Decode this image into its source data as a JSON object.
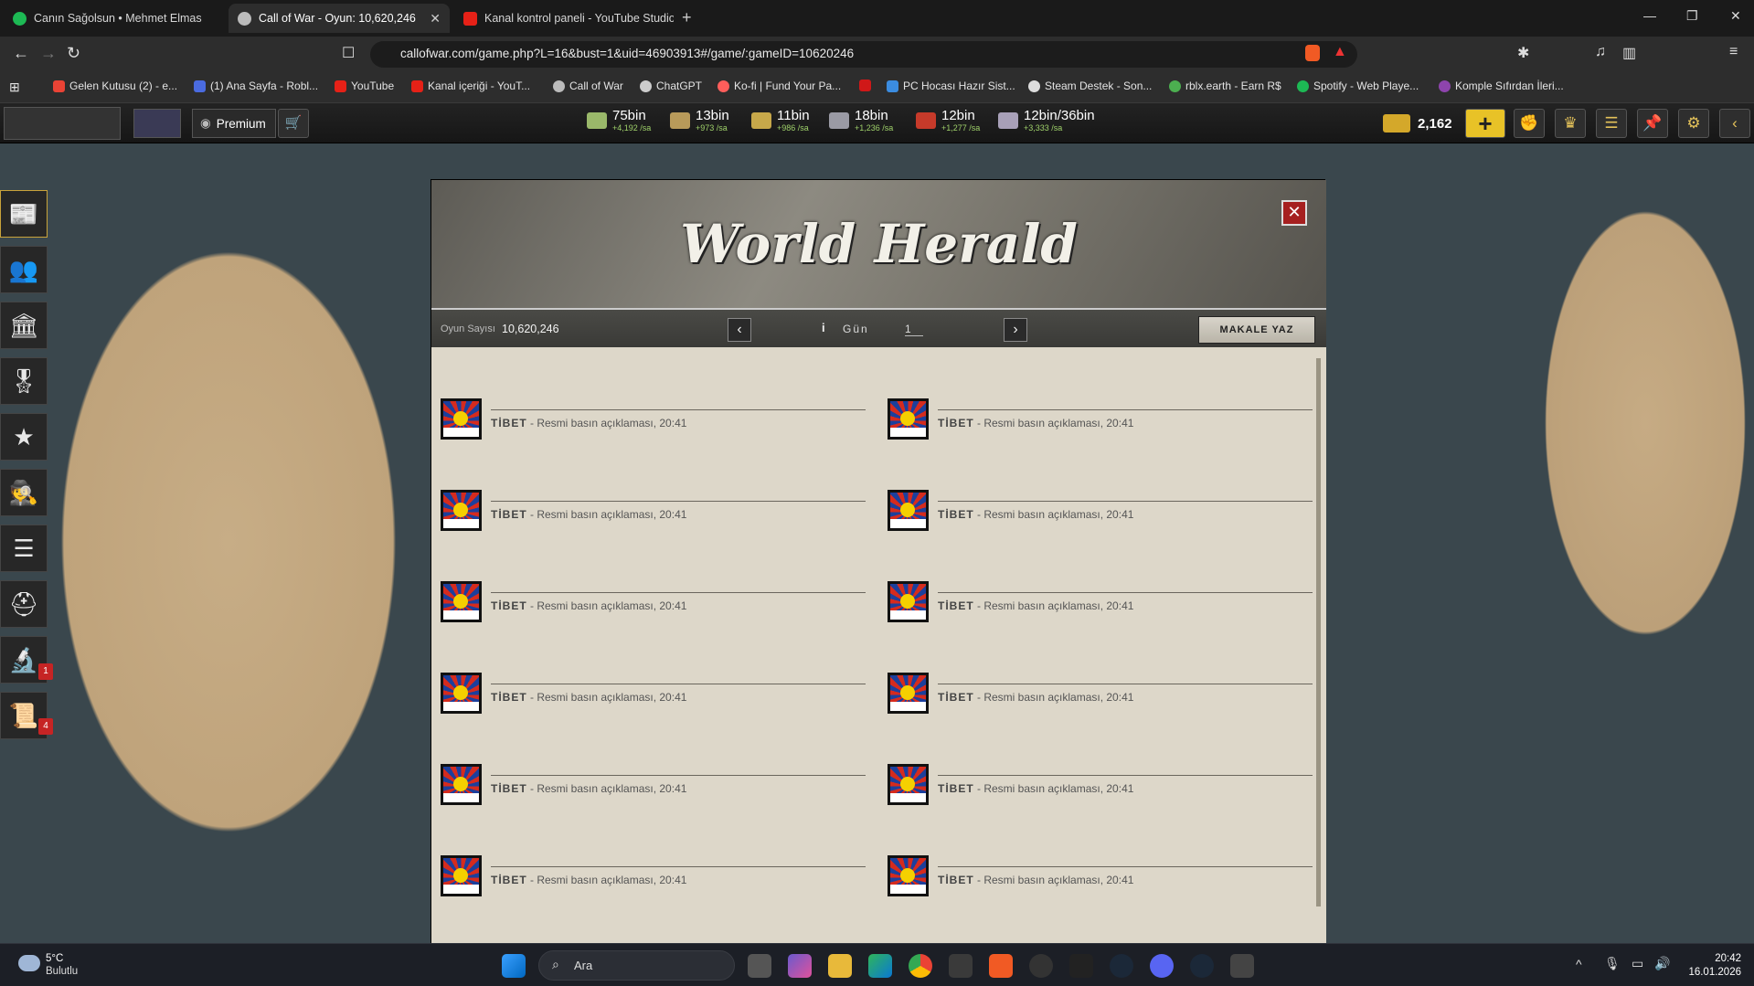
{
  "browser": {
    "tabs": [
      {
        "title": "Canın Sağolsun • Mehmet Elmas",
        "active": false,
        "favicon": "spotify-icon"
      },
      {
        "title": "Call of War - Oyun: 10,620,246",
        "active": true,
        "favicon": "call-of-war-icon"
      },
      {
        "title": "Kanal kontrol paneli - YouTube Studio",
        "active": false,
        "favicon": "youtube-icon"
      }
    ],
    "url": "callofwar.com/game.php?L=16&bust=1&uid=46903913#/game/:gameID=10620246",
    "bookmarks": [
      "Gelen Kutusu (2) - e...",
      "(1) Ana Sayfa - Robl...",
      "YouTube",
      "Kanal içeriği - YouT...",
      "Call of War",
      "ChatGPT",
      "Ko-fi | Fund Your Pa...",
      "PC Hocası Hazır Sist...",
      "Steam Destek - Son...",
      "rblx.earth - Earn R$",
      "Spotify - Web Playe...",
      "Komple Sıfırdan İleri..."
    ]
  },
  "hud": {
    "premium_label": "Premium",
    "resources": [
      {
        "value": "75bin",
        "rate": "+4,192 /sa",
        "color": "#9ab86a"
      },
      {
        "value": "13bin",
        "rate": "+973 /sa",
        "color": "#b89a5a"
      },
      {
        "value": "11bin",
        "rate": "+986 /sa",
        "color": "#c7a84a"
      },
      {
        "value": "18bin",
        "rate": "+1,236 /sa",
        "color": "#9a9aa4"
      },
      {
        "value": "12bin",
        "rate": "+1,277 /sa",
        "color": "#c63a2a"
      },
      {
        "value": "12bin/36bin",
        "rate": "+3,333 /sa",
        "color": "#a8a0b8"
      }
    ],
    "gold": "2,162",
    "plus_label": "+"
  },
  "sidebar": {
    "badges": {
      "research": "1",
      "missions": "4"
    }
  },
  "herald": {
    "title": "World Herald",
    "game_label": "Oyun Sayısı",
    "game_number": "10,620,246",
    "day_label": "Gün",
    "day_number": "1",
    "write_button": "MAKALE YAZ",
    "articles": [
      {
        "country": "TİBET",
        "text": " - Resmi basın açıklaması, 20:41"
      },
      {
        "country": "TİBET",
        "text": " - Resmi basın açıklaması, 20:41"
      },
      {
        "country": "TİBET",
        "text": " - Resmi basın açıklaması, 20:41"
      },
      {
        "country": "TİBET",
        "text": " - Resmi basın açıklaması, 20:41"
      },
      {
        "country": "TİBET",
        "text": " - Resmi basın açıklaması, 20:41"
      },
      {
        "country": "TİBET",
        "text": " - Resmi basın açıklaması, 20:41"
      },
      {
        "country": "TİBET",
        "text": " - Resmi basın açıklaması, 20:41"
      },
      {
        "country": "TİBET",
        "text": " - Resmi basın açıklaması, 20:41"
      },
      {
        "country": "TİBET",
        "text": " - Resmi basın açıklaması, 20:41"
      },
      {
        "country": "TİBET",
        "text": " - Resmi basın açıklaması, 20:41"
      },
      {
        "country": "TİBET",
        "text": " - Resmi basın açıklaması, 20:41"
      },
      {
        "country": "TİBET",
        "text": " - Resmi basın açıklaması, 20:41"
      }
    ]
  },
  "taskbar": {
    "weather_temp": "5°C",
    "weather_desc": "Bulutlu",
    "search_placeholder": "Ara",
    "time": "20:42",
    "date": "16.01.2026"
  }
}
